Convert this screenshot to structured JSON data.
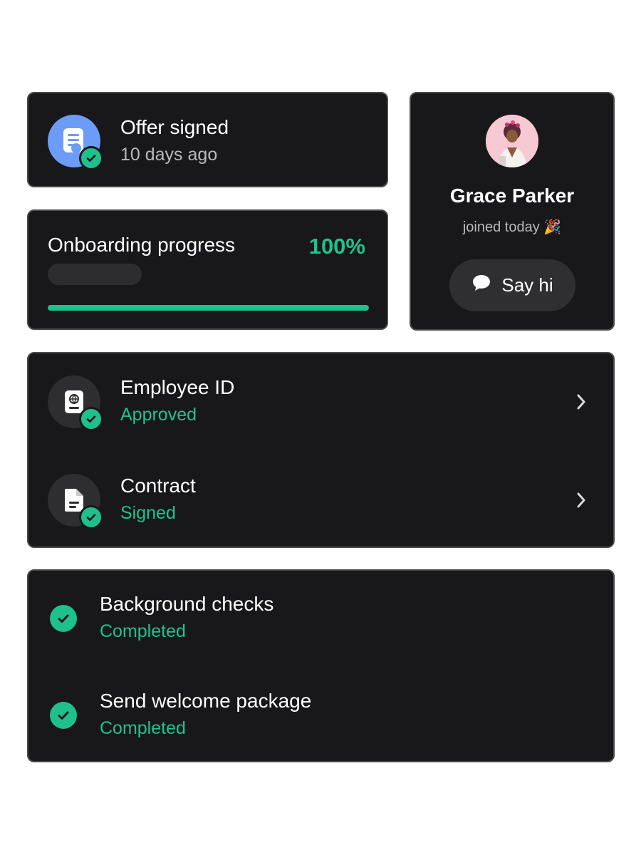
{
  "offer": {
    "title": "Offer signed",
    "subtitle": "10 days ago",
    "icon": "document-icon",
    "badge_icon": "check-icon"
  },
  "progress": {
    "title": "Onboarding progress",
    "percent_label": "100%",
    "value": 1.0
  },
  "profile": {
    "name": "Grace Parker",
    "status": "joined today 🎉",
    "button_label": "Say hi",
    "button_icon": "chat-bubble-icon"
  },
  "documents": [
    {
      "title": "Employee ID",
      "status": "Approved",
      "icon": "id-badge-icon"
    },
    {
      "title": "Contract",
      "status": "Signed",
      "icon": "file-icon"
    }
  ],
  "tasks": [
    {
      "title": "Background checks",
      "status": "Completed"
    },
    {
      "title": "Send welcome package",
      "status": "Completed"
    }
  ],
  "colors": {
    "card_bg": "#18181a",
    "card_border": "#4a4a4d",
    "accent_green": "#1fc08c",
    "accent_blue": "#6d9bf8",
    "muted_text": "#b9b9bc"
  }
}
